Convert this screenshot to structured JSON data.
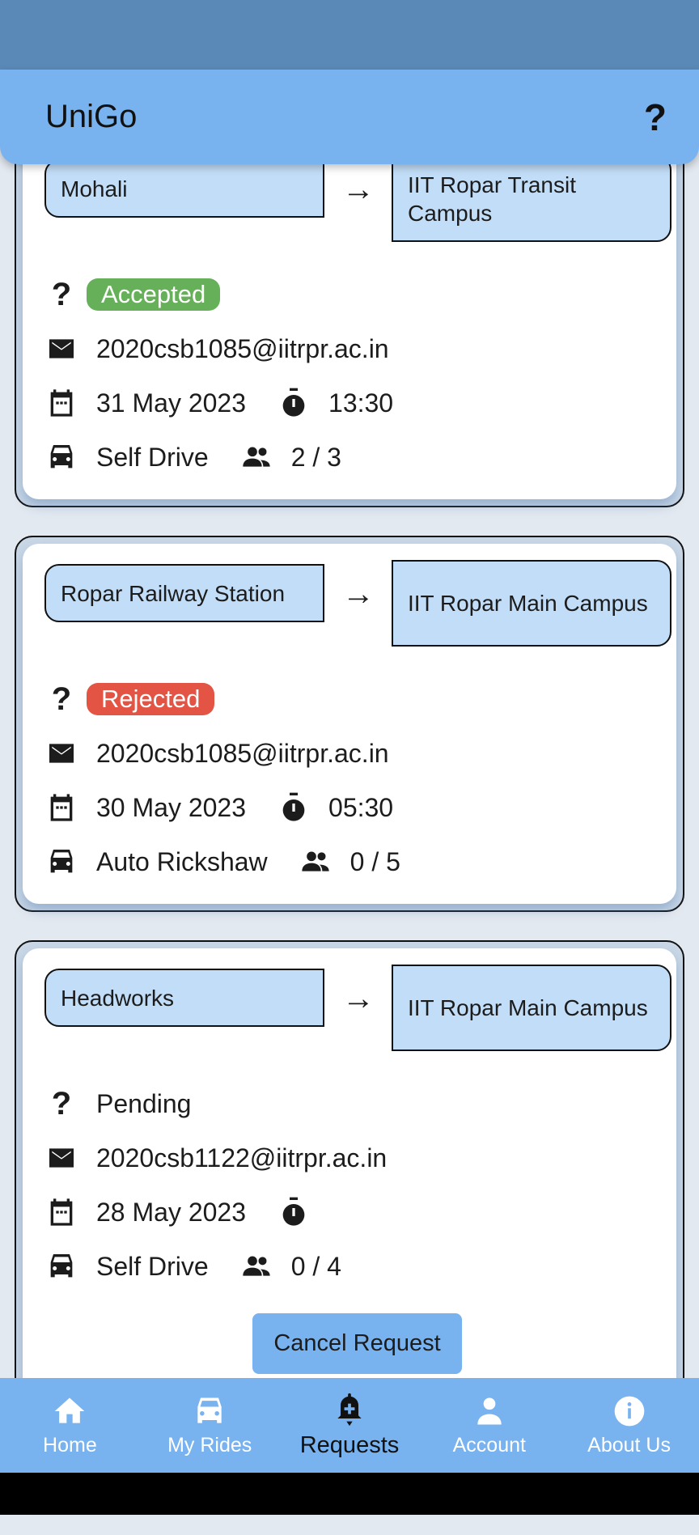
{
  "app": {
    "title": "UniGo",
    "help_label": "?"
  },
  "requests": [
    {
      "from": "Mohali",
      "to": "IIT Ropar Transit Campus",
      "status": "Accepted",
      "status_color": "#66b05a",
      "email": "2020csb1085@iitrpr.ac.in",
      "date": "31 May 2023",
      "time": "13:30",
      "vehicle": "Self Drive",
      "seats": "2 / 3"
    },
    {
      "from": "Ropar Railway Station",
      "to": "IIT Ropar Main Campus",
      "status": "Rejected",
      "status_color": "#e35445",
      "email": "2020csb1085@iitrpr.ac.in",
      "date": "30 May 2023",
      "time": "05:30",
      "vehicle": "Auto Rickshaw",
      "seats": "0 / 5"
    },
    {
      "from": "Headworks",
      "to": "IIT Ropar Main Campus",
      "status": "Pending",
      "email": "2020csb1122@iitrpr.ac.in",
      "date": "28 May 2023",
      "time": "",
      "vehicle": "Self Drive",
      "seats": "0 / 4",
      "cancel_label": "Cancel Request"
    }
  ],
  "nav": [
    {
      "label": "Home",
      "icon": "home-icon"
    },
    {
      "label": "My Rides",
      "icon": "car-icon"
    },
    {
      "label": "Requests",
      "icon": "bell-plus-icon",
      "active": true
    },
    {
      "label": "Account",
      "icon": "person-icon"
    },
    {
      "label": "About Us",
      "icon": "info-icon"
    }
  ]
}
